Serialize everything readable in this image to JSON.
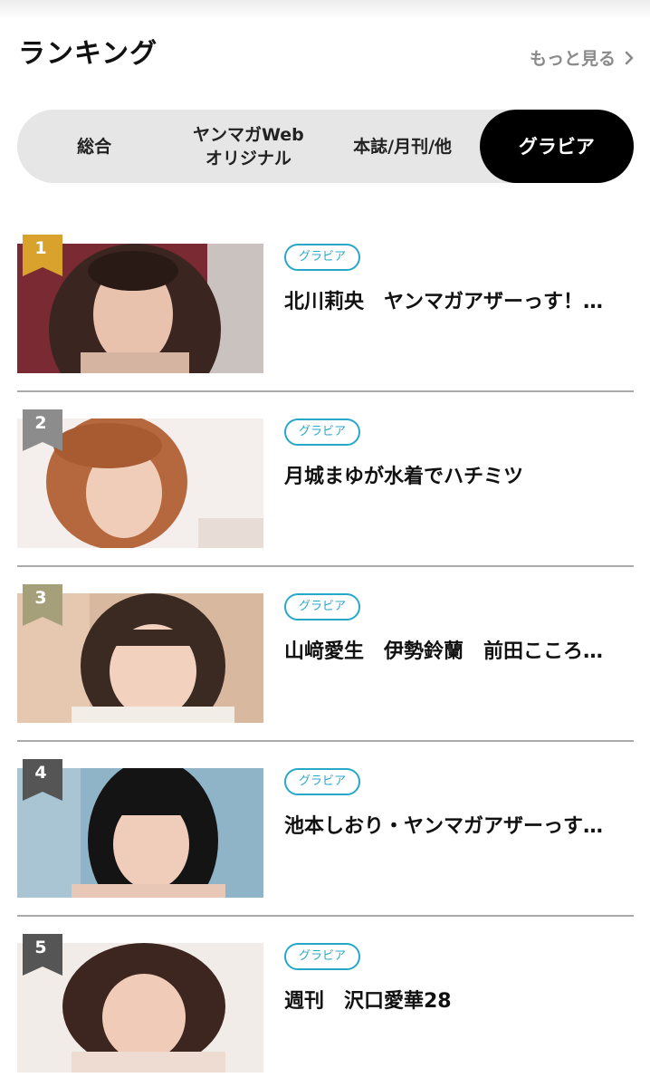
{
  "header": {
    "title": "ランキング",
    "more_label": "もっと見る"
  },
  "tabs": [
    {
      "label": "総合",
      "active": false
    },
    {
      "label": "ヤンマガWeb\nオリジナル",
      "active": false
    },
    {
      "label": "本誌/月刊/他",
      "active": false
    },
    {
      "label": "グラビア",
      "active": true
    }
  ],
  "items": [
    {
      "rank": "1",
      "badge_color": "#d9a22c",
      "tag": "グラビア",
      "title": "北川莉央　ヤンマガアザーっす！…"
    },
    {
      "rank": "2",
      "badge_color": "#8c8c8c",
      "tag": "グラビア",
      "title": "月城まゆが水着でハチミツ"
    },
    {
      "rank": "3",
      "badge_color": "#a6a07a",
      "tag": "グラビア",
      "title": "山﨑愛生　伊勢鈴蘭　前田こころ…"
    },
    {
      "rank": "4",
      "badge_color": "#555555",
      "tag": "グラビア",
      "title": "池本しおり・ヤンマガアザーっす…"
    },
    {
      "rank": "5",
      "badge_color": "#555555",
      "tag": "グラビア",
      "title": "週刊　沢口愛華28"
    }
  ]
}
